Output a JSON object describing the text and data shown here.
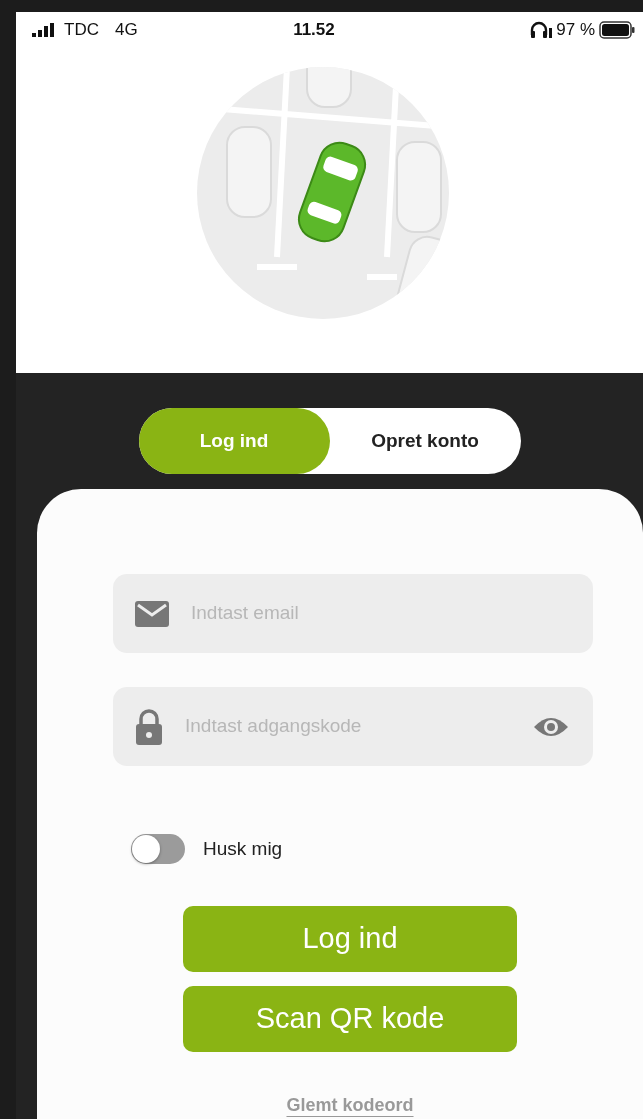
{
  "status_bar": {
    "carrier": "TDC",
    "network": "4G",
    "time": "11.52",
    "battery": "97 %"
  },
  "tabs": [
    {
      "label": "Log ind",
      "selected": true
    },
    {
      "label": "Opret konto",
      "selected": false
    }
  ],
  "fields": [
    {
      "kind": "email",
      "placeholder": "Indtast email"
    },
    {
      "kind": "password",
      "placeholder": "Indtast adgangskode"
    }
  ],
  "remember": {
    "label": "Husk mig",
    "on": false
  },
  "buttons": [
    "Log ind",
    "Scan QR kode"
  ],
  "forgot_link": "Glemt kodeord"
}
